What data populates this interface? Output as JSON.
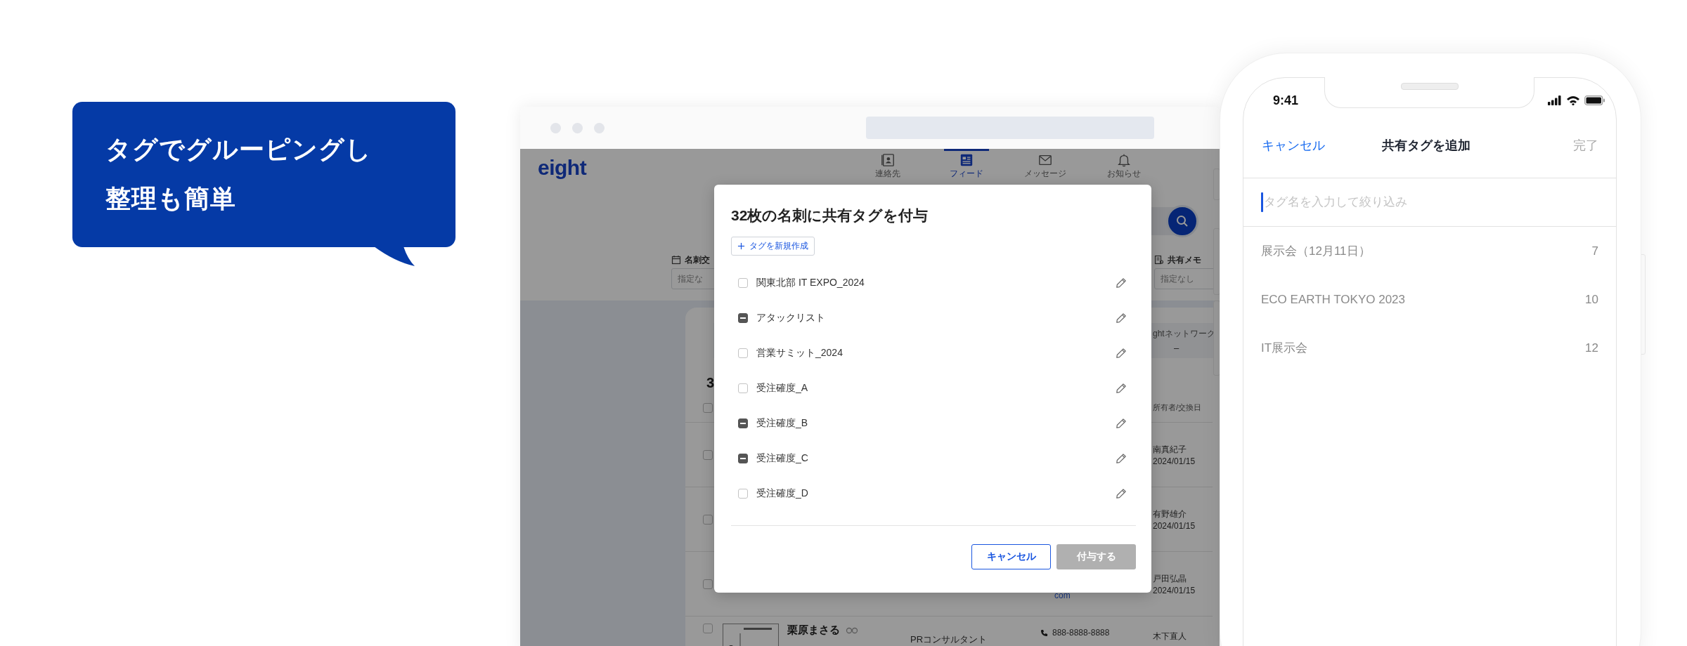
{
  "promo": {
    "lines": [
      "タグでグルーピングし",
      "整理も簡単"
    ]
  },
  "browser": {
    "logo": "eight",
    "nav": [
      {
        "label": "連絡先",
        "kind": "contacts",
        "selected": false
      },
      {
        "label": "フィード",
        "kind": "feed",
        "selected": true
      },
      {
        "label": "メッセージ",
        "kind": "message",
        "selected": false
      },
      {
        "label": "お知らせ",
        "kind": "bell",
        "selected": false
      }
    ],
    "filters": [
      {
        "label": "名刺交",
        "kind": "calendar",
        "placeholder": "指定な"
      },
      {
        "label": "共有メモ",
        "kind": "memo",
        "placeholder": "指定なし"
      }
    ],
    "stats": {
      "label": "ghtネットワーク",
      "value": "–"
    },
    "list_title": "3",
    "owner_column": "所有者/交換日",
    "all_checked": false,
    "rows": [
      {
        "owner": "南真紀子",
        "date": "2024/01/15",
        "checked": false
      },
      {
        "owner": "有野雄介",
        "date": "2024/01/15",
        "checked": false
      },
      {
        "owner": "戸田弘晶",
        "date": "2024/01/15",
        "email": "com",
        "checked": false
      },
      {
        "name": "栗原まさる",
        "title": "PRコンサルタント",
        "phone": "888-8888-8888",
        "owner": "木下直人",
        "checked": false
      }
    ]
  },
  "dialog": {
    "title": "32枚の名刺に共有タグを付与",
    "new_tag_button": "タグを新規作成",
    "tags": [
      {
        "name": "関東北部 IT EXPO_2024",
        "partial": false
      },
      {
        "name": "アタックリスト",
        "partial": true
      },
      {
        "name": "営業サミット_2024",
        "partial": false
      },
      {
        "name": "受注確度_A",
        "partial": false
      },
      {
        "name": "受注確度_B",
        "partial": true
      },
      {
        "name": "受注確度_C",
        "partial": true
      },
      {
        "name": "受注確度_D",
        "partial": false
      }
    ],
    "buttons": [
      {
        "label": "キャンセル",
        "kind": "secondary",
        "disabled": false
      },
      {
        "label": "付与する",
        "kind": "primary",
        "disabled": true
      }
    ]
  },
  "phone": {
    "time": "9:41",
    "cancel": "キャンセル",
    "title": "共有タグを追加",
    "done": {
      "label": "完了",
      "disabled": true
    },
    "search": {
      "placeholder": "タグ名を入力して絞り込み"
    },
    "tags": [
      {
        "name": "展示会（12月11日）",
        "count": "7"
      },
      {
        "name": "ECO EARTH TOKYO 2023",
        "count": "10"
      },
      {
        "name": "IT展示会",
        "count": "12"
      }
    ]
  }
}
